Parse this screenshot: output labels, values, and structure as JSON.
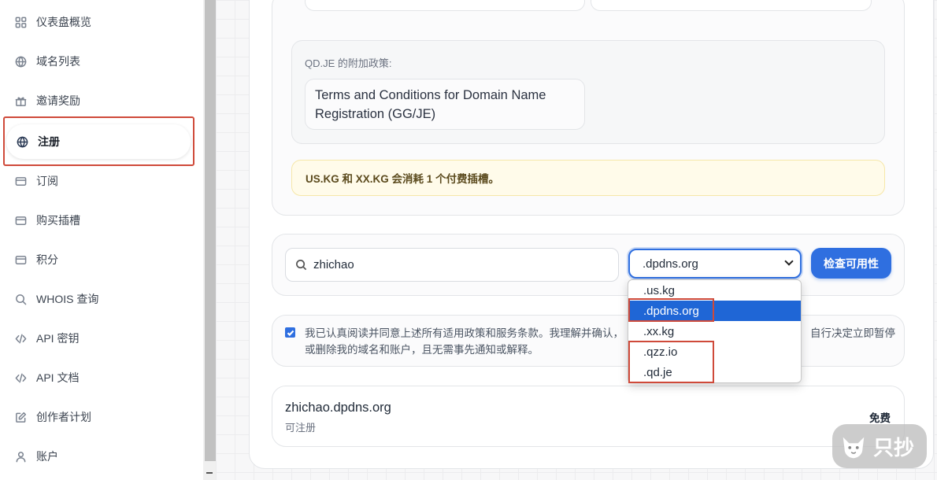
{
  "sidebar": {
    "items": [
      {
        "label": "仪表盘概览",
        "icon": "grid-icon"
      },
      {
        "label": "域名列表",
        "icon": "globe-icon"
      },
      {
        "label": "邀请奖励",
        "icon": "gift-icon"
      },
      {
        "label": "注册",
        "icon": "globe-icon",
        "active": true
      },
      {
        "label": "订阅",
        "icon": "card-icon"
      },
      {
        "label": "购买插槽",
        "icon": "card-icon"
      },
      {
        "label": "积分",
        "icon": "card-icon"
      },
      {
        "label": "WHOIS 查询",
        "icon": "search-icon"
      },
      {
        "label": "API 密钥",
        "icon": "code-icon"
      },
      {
        "label": "API 文档",
        "icon": "code-icon"
      },
      {
        "label": "创作者计划",
        "icon": "edit-icon"
      },
      {
        "label": "账户",
        "icon": "user-icon"
      }
    ]
  },
  "policy": {
    "additional_title": "QD.JE 的附加政策:",
    "terms_link": "Terms and Conditions for Domain Name Registration (GG/JE)",
    "warning": "US.KG 和 XX.KG 会消耗 1 个付费插槽。"
  },
  "search": {
    "query": "zhichao",
    "selected_suffix": ".dpdns.org",
    "check_button": "检查可用性",
    "options": [
      ".us.kg",
      ".dpdns.org",
      ".xx.kg",
      ".qzz.io",
      ".qd.je"
    ]
  },
  "agreement": {
    "checked": true,
    "text": "我已认真阅读并同意上述所有适用政策和服务条款。我理解并确认，",
    "text_tail": "自行决定立即暂停",
    "text_line2": "或删除我的域名和账户，且无需事先通知或解释。"
  },
  "result": {
    "domain": "zhichao.dpdns.org",
    "status": "可注册",
    "price": "免费"
  },
  "watermark": {
    "text": "只抄"
  },
  "colors": {
    "accent": "#2f6fe0",
    "highlight": "#cf4a3a",
    "warning_bg": "#fffbea"
  }
}
